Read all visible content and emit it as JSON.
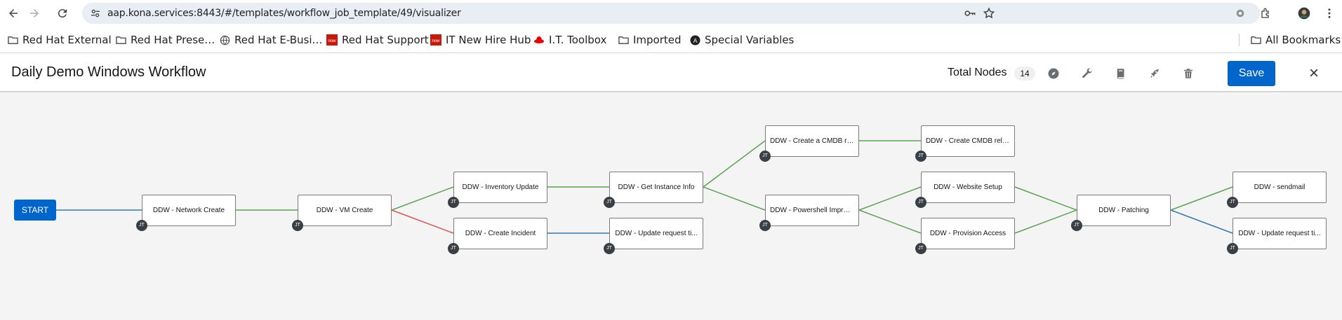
{
  "browser": {
    "url": "aap.kona.services:8443/#/templates/workflow_job_template/49/visualizer"
  },
  "bookmarks": [
    {
      "label": "Red Hat External",
      "icon": "folder-icon"
    },
    {
      "label": "Red Hat Prese…",
      "icon": "folder-icon"
    },
    {
      "label": "Red Hat E-Busi…",
      "icon": "globe-icon"
    },
    {
      "label": "Red Hat Support",
      "icon": "now-icon"
    },
    {
      "label": "IT New Hire Hub",
      "icon": "now-icon"
    },
    {
      "label": "I.T. Toolbox",
      "icon": "redhat-icon"
    },
    {
      "label": "Imported",
      "icon": "folder-icon"
    },
    {
      "label": "Special Variables",
      "icon": "circle-a-icon"
    }
  ],
  "all_bookmarks": "All Bookmarks",
  "header": {
    "title": "Daily Demo Windows Workflow",
    "total_nodes_label": "Total Nodes",
    "total_nodes_count": "14",
    "save_label": "Save",
    "close_label": "×"
  },
  "workflow": {
    "start_label": "START",
    "jt_badge": "JT",
    "nodes": {
      "network_create": "DDW - Network Create",
      "vm_create": "DDW - VM Create",
      "inventory_update": "DDW - Inventory Update",
      "create_incident": "DDW - Create Incident",
      "get_instance_info": "DDW - Get Instance Info",
      "update_request_1": "DDW - Update request ti...",
      "create_cmdb_rec": "DDW - Create a CMDB re...",
      "powershell_improv": "DDW - Powershell Improv...",
      "create_cmdb_rela": "DDW - Create CMDB rela...",
      "website_setup": "DDW - Website Setup",
      "provision_access": "DDW - Provision Access",
      "patching": "DDW - Patching",
      "sendmail": "DDW - sendmail",
      "update_request_2": "DDW - Update request ti..."
    }
  },
  "colors": {
    "success_link": "#5ba352",
    "failure_link": "#d9534f",
    "always_link": "#337ab7",
    "primary": "#0066cc"
  }
}
